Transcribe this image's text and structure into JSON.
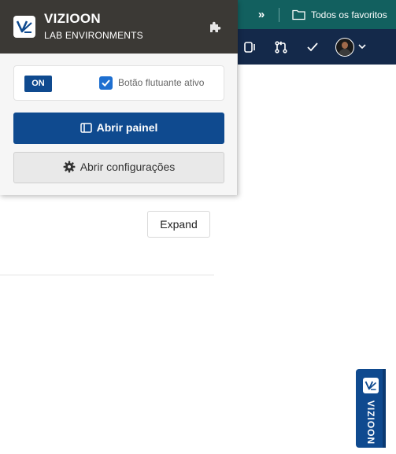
{
  "browser": {
    "favorites_label": "Todos os favoritos",
    "chevrons_icon": "double-chevron-right-icon",
    "folder_icon": "folder-icon"
  },
  "header_icons": [
    "tablet-icon",
    "git-pull-request-icon",
    "checkbox-icon",
    "avatar",
    "chevron-down-icon"
  ],
  "popup": {
    "brand_title": "VIZIOON",
    "brand_subtitle": "LAB ENVIRONMENTS",
    "extension_icon": "puzzle-icon",
    "toggle_state": "ON",
    "checkbox_label": "Botão flutuante ativo",
    "checkbox_checked": true,
    "open_panel_label": "Abrir painel",
    "open_settings_label": "Abrir configurações"
  },
  "page": {
    "expand_label": "Expand"
  },
  "floating_tab": {
    "label": "VIZIOON"
  },
  "colors": {
    "browser_bar": "#12605f",
    "app_header": "#14294a",
    "popup_header": "#3b3935",
    "primary": "#0f4a8f"
  }
}
